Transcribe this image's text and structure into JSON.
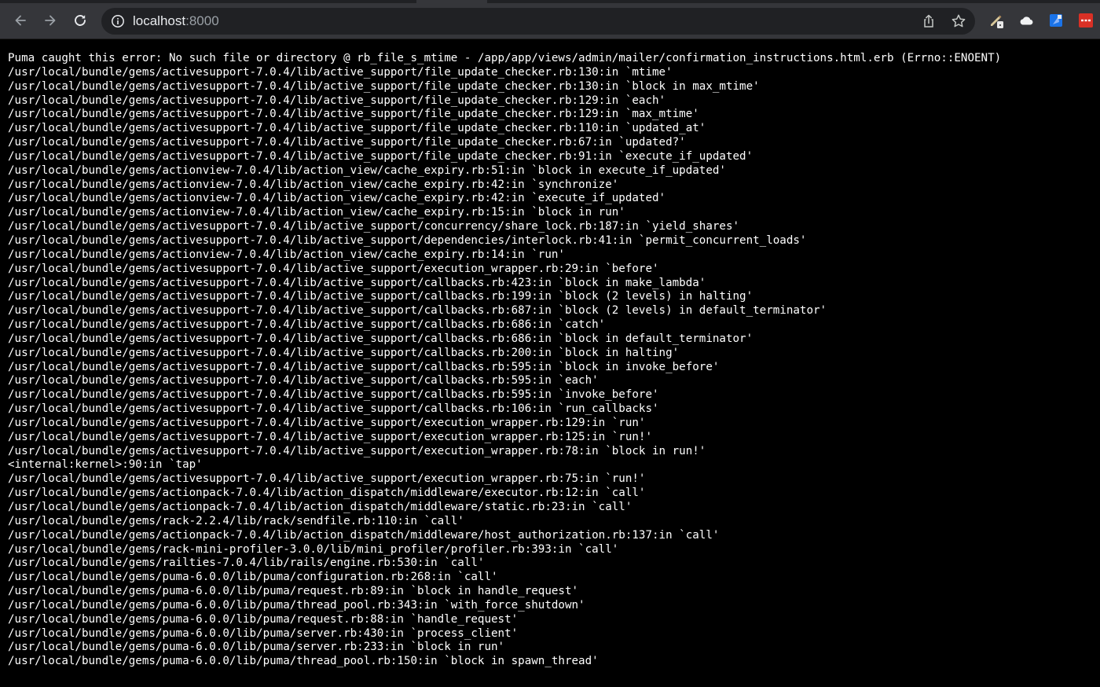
{
  "browser": {
    "url_host": "localhost",
    "url_port": ":8000",
    "icons": {
      "back": "arrow-left-icon",
      "forward": "arrow-right-icon",
      "reload": "reload-icon",
      "site_info": "info-circle-icon",
      "share": "share-icon",
      "bookmark": "star-icon"
    },
    "extensions": [
      "pencil-extension-icon",
      "cloud-extension-icon",
      "blue-extension-icon",
      "red-extension-icon"
    ]
  },
  "page": {
    "error_header": "Puma caught this error: No such file or directory @ rb_file_s_mtime - /app/app/views/admin/mailer/confirmation_instructions.html.erb (Errno::ENOENT)",
    "backtrace": [
      "/usr/local/bundle/gems/activesupport-7.0.4/lib/active_support/file_update_checker.rb:130:in `mtime'",
      "/usr/local/bundle/gems/activesupport-7.0.4/lib/active_support/file_update_checker.rb:130:in `block in max_mtime'",
      "/usr/local/bundle/gems/activesupport-7.0.4/lib/active_support/file_update_checker.rb:129:in `each'",
      "/usr/local/bundle/gems/activesupport-7.0.4/lib/active_support/file_update_checker.rb:129:in `max_mtime'",
      "/usr/local/bundle/gems/activesupport-7.0.4/lib/active_support/file_update_checker.rb:110:in `updated_at'",
      "/usr/local/bundle/gems/activesupport-7.0.4/lib/active_support/file_update_checker.rb:67:in `updated?'",
      "/usr/local/bundle/gems/activesupport-7.0.4/lib/active_support/file_update_checker.rb:91:in `execute_if_updated'",
      "/usr/local/bundle/gems/actionview-7.0.4/lib/action_view/cache_expiry.rb:51:in `block in execute_if_updated'",
      "/usr/local/bundle/gems/actionview-7.0.4/lib/action_view/cache_expiry.rb:42:in `synchronize'",
      "/usr/local/bundle/gems/actionview-7.0.4/lib/action_view/cache_expiry.rb:42:in `execute_if_updated'",
      "/usr/local/bundle/gems/actionview-7.0.4/lib/action_view/cache_expiry.rb:15:in `block in run'",
      "/usr/local/bundle/gems/activesupport-7.0.4/lib/active_support/concurrency/share_lock.rb:187:in `yield_shares'",
      "/usr/local/bundle/gems/activesupport-7.0.4/lib/active_support/dependencies/interlock.rb:41:in `permit_concurrent_loads'",
      "/usr/local/bundle/gems/actionview-7.0.4/lib/action_view/cache_expiry.rb:14:in `run'",
      "/usr/local/bundle/gems/activesupport-7.0.4/lib/active_support/execution_wrapper.rb:29:in `before'",
      "/usr/local/bundle/gems/activesupport-7.0.4/lib/active_support/callbacks.rb:423:in `block in make_lambda'",
      "/usr/local/bundle/gems/activesupport-7.0.4/lib/active_support/callbacks.rb:199:in `block (2 levels) in halting'",
      "/usr/local/bundle/gems/activesupport-7.0.4/lib/active_support/callbacks.rb:687:in `block (2 levels) in default_terminator'",
      "/usr/local/bundle/gems/activesupport-7.0.4/lib/active_support/callbacks.rb:686:in `catch'",
      "/usr/local/bundle/gems/activesupport-7.0.4/lib/active_support/callbacks.rb:686:in `block in default_terminator'",
      "/usr/local/bundle/gems/activesupport-7.0.4/lib/active_support/callbacks.rb:200:in `block in halting'",
      "/usr/local/bundle/gems/activesupport-7.0.4/lib/active_support/callbacks.rb:595:in `block in invoke_before'",
      "/usr/local/bundle/gems/activesupport-7.0.4/lib/active_support/callbacks.rb:595:in `each'",
      "/usr/local/bundle/gems/activesupport-7.0.4/lib/active_support/callbacks.rb:595:in `invoke_before'",
      "/usr/local/bundle/gems/activesupport-7.0.4/lib/active_support/callbacks.rb:106:in `run_callbacks'",
      "/usr/local/bundle/gems/activesupport-7.0.4/lib/active_support/execution_wrapper.rb:129:in `run'",
      "/usr/local/bundle/gems/activesupport-7.0.4/lib/active_support/execution_wrapper.rb:125:in `run!'",
      "/usr/local/bundle/gems/activesupport-7.0.4/lib/active_support/execution_wrapper.rb:78:in `block in run!'",
      "<internal:kernel>:90:in `tap'",
      "/usr/local/bundle/gems/activesupport-7.0.4/lib/active_support/execution_wrapper.rb:75:in `run!'",
      "/usr/local/bundle/gems/actionpack-7.0.4/lib/action_dispatch/middleware/executor.rb:12:in `call'",
      "/usr/local/bundle/gems/actionpack-7.0.4/lib/action_dispatch/middleware/static.rb:23:in `call'",
      "/usr/local/bundle/gems/rack-2.2.4/lib/rack/sendfile.rb:110:in `call'",
      "/usr/local/bundle/gems/actionpack-7.0.4/lib/action_dispatch/middleware/host_authorization.rb:137:in `call'",
      "/usr/local/bundle/gems/rack-mini-profiler-3.0.0/lib/mini_profiler/profiler.rb:393:in `call'",
      "/usr/local/bundle/gems/railties-7.0.4/lib/rails/engine.rb:530:in `call'",
      "/usr/local/bundle/gems/puma-6.0.0/lib/puma/configuration.rb:268:in `call'",
      "/usr/local/bundle/gems/puma-6.0.0/lib/puma/request.rb:89:in `block in handle_request'",
      "/usr/local/bundle/gems/puma-6.0.0/lib/puma/thread_pool.rb:343:in `with_force_shutdown'",
      "/usr/local/bundle/gems/puma-6.0.0/lib/puma/request.rb:88:in `handle_request'",
      "/usr/local/bundle/gems/puma-6.0.0/lib/puma/server.rb:430:in `process_client'",
      "/usr/local/bundle/gems/puma-6.0.0/lib/puma/server.rb:233:in `block in run'",
      "/usr/local/bundle/gems/puma-6.0.0/lib/puma/thread_pool.rb:150:in `block in spawn_thread'"
    ]
  },
  "colors": {
    "chrome_bg": "#35363a",
    "omnibox_bg": "#202124",
    "page_bg": "#000000",
    "text": "#ffffff"
  }
}
